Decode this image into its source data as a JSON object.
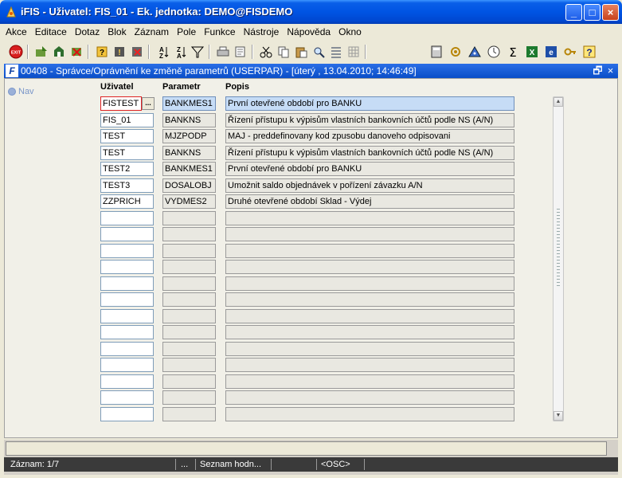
{
  "window": {
    "title": "iFIS - Uživatel: FIS_01 - Ek. jednotka: DEMO@FISDEMO",
    "minimize": "_",
    "maximize": "□",
    "close": "×"
  },
  "menu": {
    "items": [
      "Akce",
      "Editace",
      "Dotaz",
      "Blok",
      "Záznam",
      "Pole",
      "Funkce",
      "Nástroje",
      "Nápověda",
      "Okno"
    ]
  },
  "toolbar": {
    "exit_label": "EXIT",
    "icons": [
      "exit-icon",
      "save-icon",
      "commit-icon",
      "cancel-icon",
      "enter-query-icon",
      "execute-query-icon",
      "cancel-query-icon",
      "sort-asc-icon",
      "sort-desc-icon",
      "filter-icon",
      "print-icon",
      "print-preview-icon",
      "cut-icon",
      "copy-icon",
      "paste-icon",
      "find-icon",
      "list-icon",
      "grid-icon",
      "calculator-icon",
      "settings-icon",
      "warning-icon",
      "clock-icon",
      "sum-icon",
      "excel-icon",
      "word-icon",
      "key-icon",
      "help-icon"
    ]
  },
  "mdi": {
    "icon_label": "F",
    "title": "00408 - Správce/Oprávnění ke změně parametrů (USERPAR) - [úterý , 13.04.2010; 14:46:49]",
    "restore": "🗗",
    "close": "×"
  },
  "nav": {
    "label": "Nav"
  },
  "table": {
    "headers": {
      "user": "Uživatel",
      "param": "Parametr",
      "desc": "Popis"
    },
    "rows": [
      {
        "user": "FISTEST",
        "param": "BANKMES1",
        "desc": "První otevřené období pro BANKU"
      },
      {
        "user": "FIS_01",
        "param": "BANKNS",
        "desc": "Řízení přístupu k výpisům vlastních bankovních účtů podle NS (A/N)"
      },
      {
        "user": "TEST",
        "param": "MJZPODP",
        "desc": "MAJ - preddefinovany kod zpusobu danoveho odpisovani"
      },
      {
        "user": "TEST",
        "param": "BANKNS",
        "desc": "Řízení přístupu k výpisům vlastních bankovních účtů podle NS (A/N)"
      },
      {
        "user": "TEST2",
        "param": "BANKMES1",
        "desc": "První otevřené období pro BANKU"
      },
      {
        "user": "TEST3",
        "param": "DOSALOBJ",
        "desc": "Umožnit saldo objednávek v pořízení závazku A/N"
      },
      {
        "user": "ZZPRICH",
        "param": "VYDMES2",
        "desc": "Druhé otevřené období Sklad - Výdej"
      },
      {
        "user": "",
        "param": "",
        "desc": ""
      },
      {
        "user": "",
        "param": "",
        "desc": ""
      },
      {
        "user": "",
        "param": "",
        "desc": ""
      },
      {
        "user": "",
        "param": "",
        "desc": ""
      },
      {
        "user": "",
        "param": "",
        "desc": ""
      },
      {
        "user": "",
        "param": "",
        "desc": ""
      },
      {
        "user": "",
        "param": "",
        "desc": ""
      },
      {
        "user": "",
        "param": "",
        "desc": ""
      },
      {
        "user": "",
        "param": "",
        "desc": ""
      },
      {
        "user": "",
        "param": "",
        "desc": ""
      },
      {
        "user": "",
        "param": "",
        "desc": ""
      },
      {
        "user": "",
        "param": "",
        "desc": ""
      },
      {
        "user": "",
        "param": "",
        "desc": ""
      }
    ],
    "lov_label": "..."
  },
  "status": {
    "record": "Záznam: 1/7",
    "dots": "...",
    "list": "Seznam hodn...",
    "mode": "<OSC>"
  }
}
